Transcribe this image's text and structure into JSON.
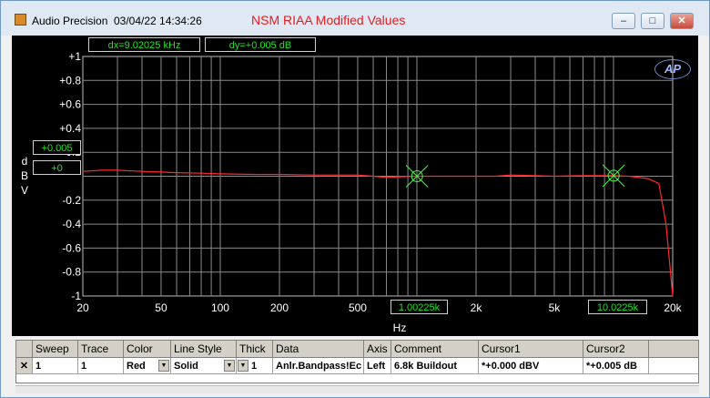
{
  "window": {
    "app_name": "Audio Precision",
    "timestamp": "03/04/22 14:34:26",
    "plot_name": "NSM RIAA Modified Values",
    "minimize_label": "–",
    "maximize_label": "□",
    "close_label": "✕"
  },
  "cursor_readouts": {
    "dx": "dx=9.02025 kHz",
    "dy": "dy=+0.005  dB",
    "cursor2_y": "+0.005",
    "cursor1_y": "+0",
    "cursor1_x": "1.00225k",
    "cursor2_x": "10.0225k"
  },
  "logo_text": "AP",
  "chart_data": {
    "type": "line",
    "xlabel": "Hz",
    "ylabel_letters": [
      "d",
      "B",
      "V"
    ],
    "x_scale": "log",
    "xlim": [
      20,
      20000
    ],
    "ylim": [
      -1,
      1
    ],
    "grid": true,
    "x_tick_labels": [
      {
        "v": 20,
        "label": "20"
      },
      {
        "v": 50,
        "label": "50"
      },
      {
        "v": 100,
        "label": "100"
      },
      {
        "v": 200,
        "label": "200"
      },
      {
        "v": 500,
        "label": "500"
      },
      {
        "v": 2000,
        "label": "2k"
      },
      {
        "v": 5000,
        "label": "5k"
      },
      {
        "v": 20000,
        "label": "20k"
      }
    ],
    "y_tick_labels": [
      {
        "v": 1,
        "label": "+1"
      },
      {
        "v": 0.8,
        "label": "+0.8"
      },
      {
        "v": 0.6,
        "label": "+0.6"
      },
      {
        "v": 0.4,
        "label": "+0.4"
      },
      {
        "v": 0.2,
        "label": "+0.2"
      },
      {
        "v": -0.2,
        "label": "-0.2"
      },
      {
        "v": -0.4,
        "label": "-0.4"
      },
      {
        "v": -0.6,
        "label": "-0.6"
      },
      {
        "v": -0.8,
        "label": "-0.8"
      },
      {
        "v": -1,
        "label": "-1"
      }
    ],
    "series": [
      {
        "color": "#ff2a2a",
        "x": [
          20,
          25,
          30,
          40,
          50,
          60,
          80,
          100,
          150,
          200,
          300,
          400,
          500,
          600,
          700,
          800,
          1000,
          1200,
          1500,
          2000,
          2500,
          3000,
          4000,
          5000,
          7000,
          10000,
          12000,
          15000,
          17000,
          18500,
          20000
        ],
        "y": [
          0.04,
          0.05,
          0.05,
          0.04,
          0.035,
          0.03,
          0.025,
          0.02,
          0.015,
          0.015,
          0.01,
          0.01,
          0.01,
          0.0,
          -0.01,
          -0.005,
          0.0,
          0.0,
          0.0,
          0.0,
          0.0,
          0.01,
          0.005,
          0.0,
          0.005,
          0.005,
          0.0,
          -0.02,
          -0.06,
          -0.4,
          -1.0
        ]
      }
    ],
    "cursors": [
      {
        "x": 1002.25,
        "y": 0.0
      },
      {
        "x": 10022.5,
        "y": 0.005
      }
    ],
    "cursor_color": "#3cff3c"
  },
  "trace_table": {
    "headers": [
      "Sweep",
      "Trace",
      "Color",
      "Line Style",
      "Thick",
      "Data",
      "Axis",
      "Comment",
      "Cursor1",
      "Cursor2"
    ],
    "rows": [
      {
        "enabled": "✕",
        "sweep": "1",
        "trace": "1",
        "color": "Red",
        "line_style": "Solid",
        "thick": "1",
        "data": "Anlr.Bandpass!Ec",
        "axis": "Left",
        "comment": "6.8k Buildout",
        "cursor1": "*+0.000  dBV",
        "cursor2": "*+0.005  dB"
      }
    ]
  }
}
